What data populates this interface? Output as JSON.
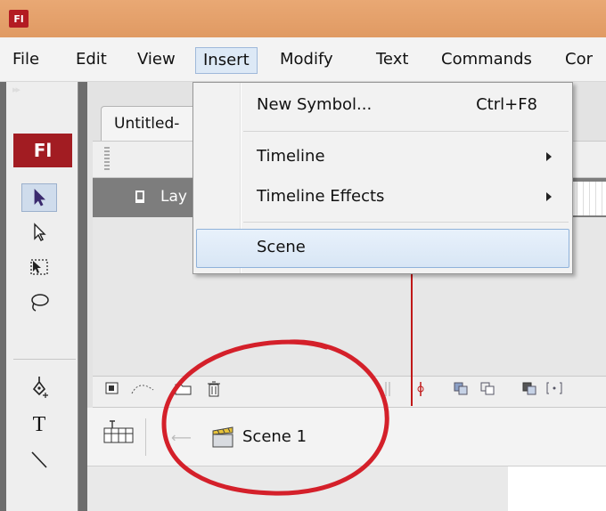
{
  "app": {
    "logo_small": "Fl",
    "logo_panel": "Fl",
    "brand_color": "#a21c22"
  },
  "menubar": {
    "items": [
      {
        "label": "File"
      },
      {
        "label": "Edit"
      },
      {
        "label": "View"
      },
      {
        "label": "Insert",
        "active": true
      },
      {
        "label": "Modify"
      },
      {
        "label": "Text"
      },
      {
        "label": "Commands"
      },
      {
        "label": "Cor"
      }
    ]
  },
  "document": {
    "tab_label": "Untitled-"
  },
  "timeline": {
    "layer_label": "Lay"
  },
  "scene": {
    "current_scene": "Scene 1"
  },
  "insert_menu": {
    "items": [
      {
        "label": "New Symbol...",
        "shortcut": "Ctrl+F8"
      },
      {
        "label": "Timeline",
        "submenu": true
      },
      {
        "label": "Timeline Effects",
        "submenu": true
      },
      {
        "label": "Scene",
        "highlighted": true
      }
    ]
  },
  "tools": [
    "selection-tool",
    "subselection-tool",
    "free-transform-tool",
    "lasso-tool",
    "pen-tool",
    "text-tool",
    "line-tool"
  ],
  "colors": {
    "titlebar": "#e4a06c",
    "menu_highlight": "#dde9f6",
    "annotation": "#d4202a",
    "playhead": "#c01818"
  }
}
